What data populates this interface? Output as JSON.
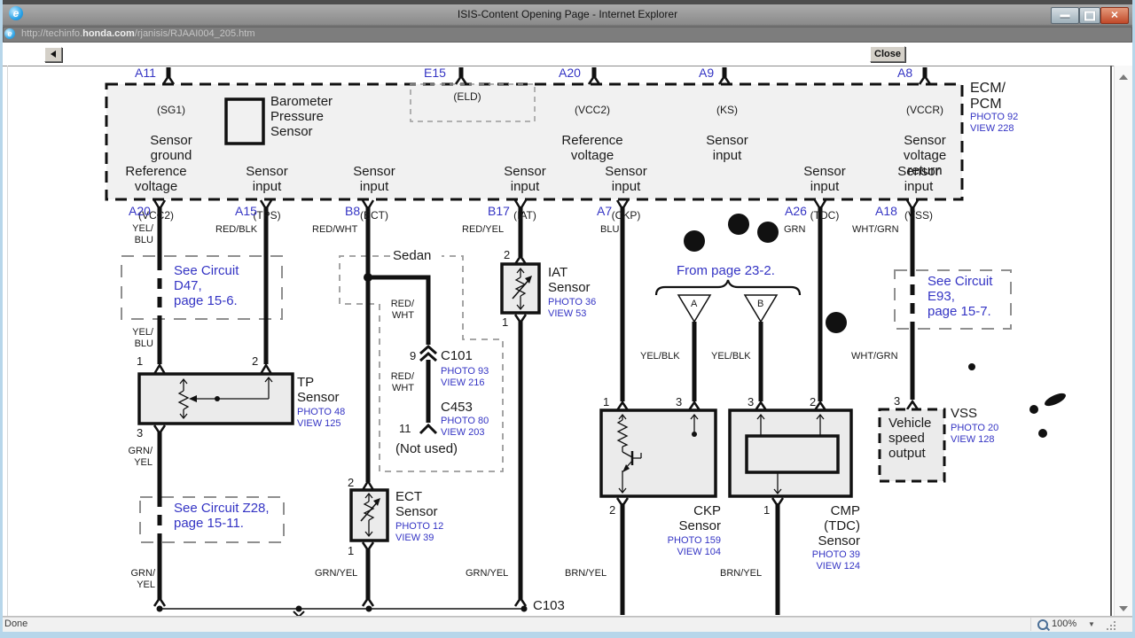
{
  "chrome": {
    "title": "ISIS-Content Opening Page - Internet Explorer",
    "url_prefix": "http://techinfo.",
    "url_domain": "honda.com",
    "url_path": "/rjanisis/RJAAI004_205.htm",
    "close_button": "Close",
    "status": "Done",
    "zoom_level": "100%",
    "accent_blue": "#3434c4"
  },
  "ecm": {
    "name": "ECM/\nPCM",
    "photo": "PHOTO 92",
    "view": "VIEW 228",
    "top_pins": [
      {
        "id": "A11",
        "tag": "(SG1)",
        "desc": "Sensor\nground"
      },
      {
        "id": "E15",
        "tag": "(ELD)",
        "desc": ""
      },
      {
        "id": "A20",
        "tag": "(VCC2)",
        "desc": "Reference\nvoltage"
      },
      {
        "id": "A9",
        "tag": "(KS)",
        "desc": "Sensor\ninput"
      },
      {
        "id": "A8",
        "tag": "(VCCR)",
        "desc": "Sensor\nvoltage\nreturn"
      }
    ],
    "barometer": "Barometer\nPressure\nSensor",
    "functions": [
      {
        "desc": "Reference\nvoltage",
        "tag": "(VCC2)"
      },
      {
        "desc": "Sensor\ninput",
        "tag": "(TPS)"
      },
      {
        "desc": "Sensor\ninput",
        "tag": "(ECT)"
      },
      {
        "desc": "Sensor\ninput",
        "tag": "(IAT)"
      },
      {
        "desc": "Sensor\ninput",
        "tag": "(CKP)"
      },
      {
        "desc": "Sensor\ninput",
        "tag": "(TDC)"
      },
      {
        "desc": "Sensor\ninput",
        "tag": "(VSS)"
      }
    ],
    "bottom_pins": [
      "A20",
      "A15",
      "B8",
      "B17",
      "A7",
      "A26",
      "A18"
    ]
  },
  "wires": {
    "a20_color": "YEL/\nBLU",
    "a15_color": "RED/BLK",
    "b8_color": "RED/WHT",
    "b17_color": "RED/YEL",
    "a7_color": "BLU",
    "a26_color": "GRN",
    "a18_color": "WHT/GRN",
    "a20_color2": "YEL/\nBLU",
    "a18_color2": "WHT/GRN",
    "tp_ground": "GRN/\nYEL",
    "tp_ground2": "GRN/\nYEL",
    "ect_ground": "GRN/YEL",
    "iat_ground": "GRN/YEL",
    "ckp_ground": "BRN/YEL",
    "cmp_ground": "BRN/YEL",
    "branch1": "RED/\nWHT",
    "branch2": "RED/\nWHT",
    "tri_a_color": "YEL/BLK",
    "tri_b_color": "YEL/BLK"
  },
  "notes": {
    "d47": "See Circuit\nD47,\npage 15-6.",
    "z28": "See Circuit Z28,\npage 15-11.",
    "e93": "See Circuit\nE93,\npage 15-7.",
    "from_page": "From page 23-2.",
    "sedan": "Sedan",
    "not_used": "(Not used)"
  },
  "connectors": {
    "c101": {
      "pin": "9",
      "name": "C101",
      "photo": "PHOTO 93",
      "view": "VIEW 216"
    },
    "c453": {
      "pin": "11",
      "name": "C453",
      "photo": "PHOTO 80",
      "view": "VIEW 203"
    },
    "c103": {
      "name": "C103"
    }
  },
  "sensors": {
    "tp": {
      "name": "TP\nSensor",
      "photo": "PHOTO 48",
      "view": "VIEW 125",
      "pin1": "1",
      "pin2": "2",
      "pin3": "3"
    },
    "iat": {
      "name": "IAT\nSensor",
      "photo": "PHOTO 36",
      "view": "VIEW 53",
      "pin_top": "2",
      "pin_bottom": "1"
    },
    "ect": {
      "name": "ECT\nSensor",
      "photo": "PHOTO 12",
      "view": "VIEW 39",
      "pin_top": "2",
      "pin_bottom": "1"
    },
    "ckp": {
      "name": "CKP\nSensor",
      "photo": "PHOTO 159",
      "view": "VIEW 104",
      "pin1": "1",
      "pin3": "3",
      "pin2": "2"
    },
    "cmp": {
      "name": "CMP\n(TDC)\nSensor",
      "photo": "PHOTO 39",
      "view": "VIEW 124",
      "pin3": "3",
      "pin2": "2",
      "pin1": "1"
    },
    "vss": {
      "name": "VSS",
      "photo": "PHOTO 20",
      "view": "VIEW 128",
      "pin3": "3",
      "label": "Vehicle\nspeed\noutput"
    }
  },
  "triangles": [
    {
      "letter": "A"
    },
    {
      "letter": "B"
    }
  ]
}
